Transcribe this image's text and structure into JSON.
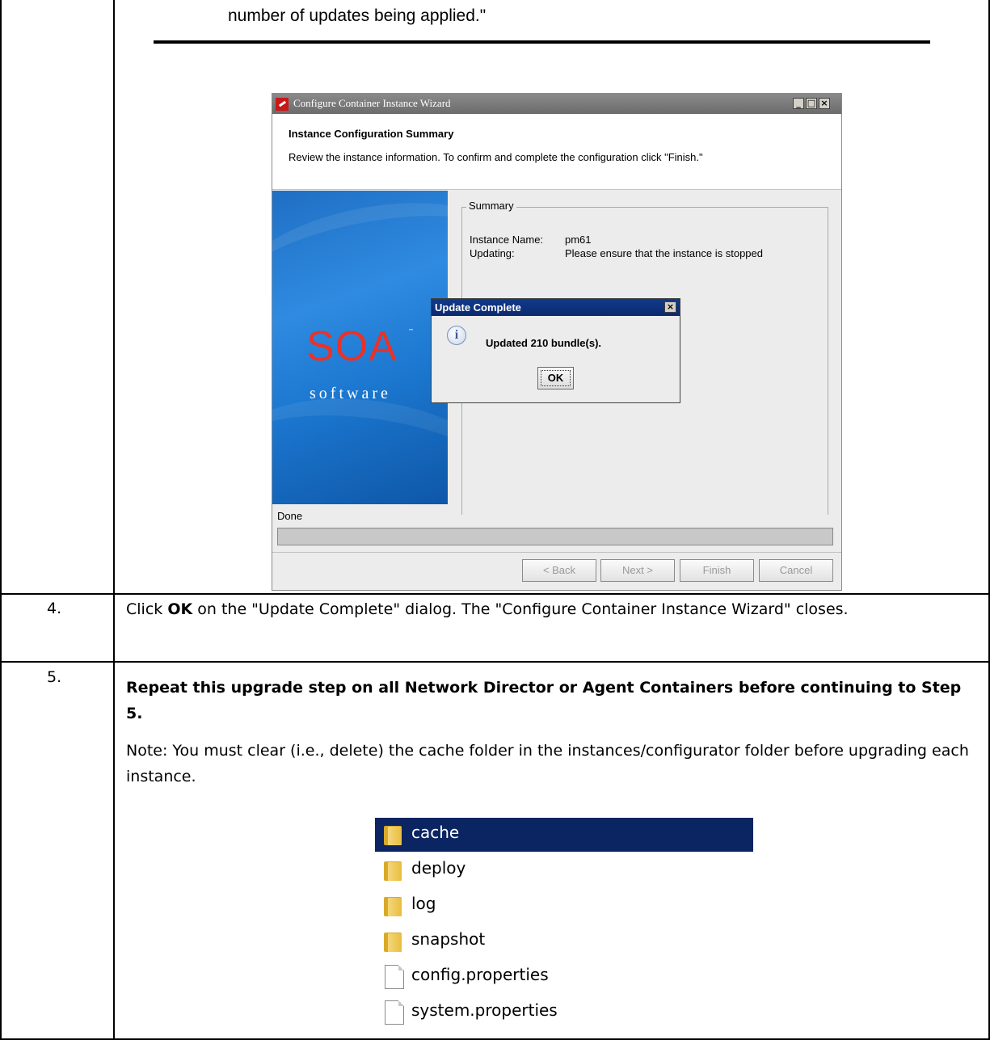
{
  "intro": {
    "continuation": "number of updates being applied.\""
  },
  "wizard": {
    "title": "Configure Container Instance Wizard",
    "header_title": "Instance Configuration Summary",
    "header_desc": "Review the instance information. To confirm and complete the configuration click \"Finish.\"",
    "brand_main": "SOA",
    "brand_tm": "™",
    "brand_sub": "software",
    "summary_legend": "Summary",
    "instance_name_label": "Instance Name:",
    "instance_name_value": "pm61",
    "updating_label": "Updating:",
    "updating_value": "Please ensure that the instance is stopped",
    "status": "Done",
    "buttons": {
      "back": "< Back",
      "next": "Next >",
      "finish": "Finish",
      "cancel": "Cancel"
    },
    "title_buttons": {
      "minimize": "_",
      "maximize": "□",
      "close": "×"
    }
  },
  "dialog": {
    "title": "Update Complete",
    "close": "×",
    "info_glyph": "i",
    "message": "Updated 210 bundle(s).",
    "ok": "OK"
  },
  "steps": [
    {
      "number": "4.",
      "text_before": "Click ",
      "text_bold": "OK",
      "text_after": " on the \"Update Complete\" dialog. The \"Configure Container Instance Wizard\" closes."
    },
    {
      "number": "5.",
      "bold_text": "Repeat this upgrade step on all Network Director or Agent Containers before continuing to Step 5.",
      "note": "Note: You must clear (i.e., delete) the cache folder in the instances/configurator folder before upgrading each instance."
    }
  ],
  "explorer": {
    "items": [
      {
        "name": "cache",
        "type": "folder",
        "selected": true
      },
      {
        "name": "deploy",
        "type": "folder",
        "selected": false
      },
      {
        "name": "log",
        "type": "folder",
        "selected": false
      },
      {
        "name": "snapshot",
        "type": "folder",
        "selected": false
      },
      {
        "name": "config.properties",
        "type": "file",
        "selected": false
      },
      {
        "name": "system.properties",
        "type": "file",
        "selected": false
      }
    ]
  }
}
